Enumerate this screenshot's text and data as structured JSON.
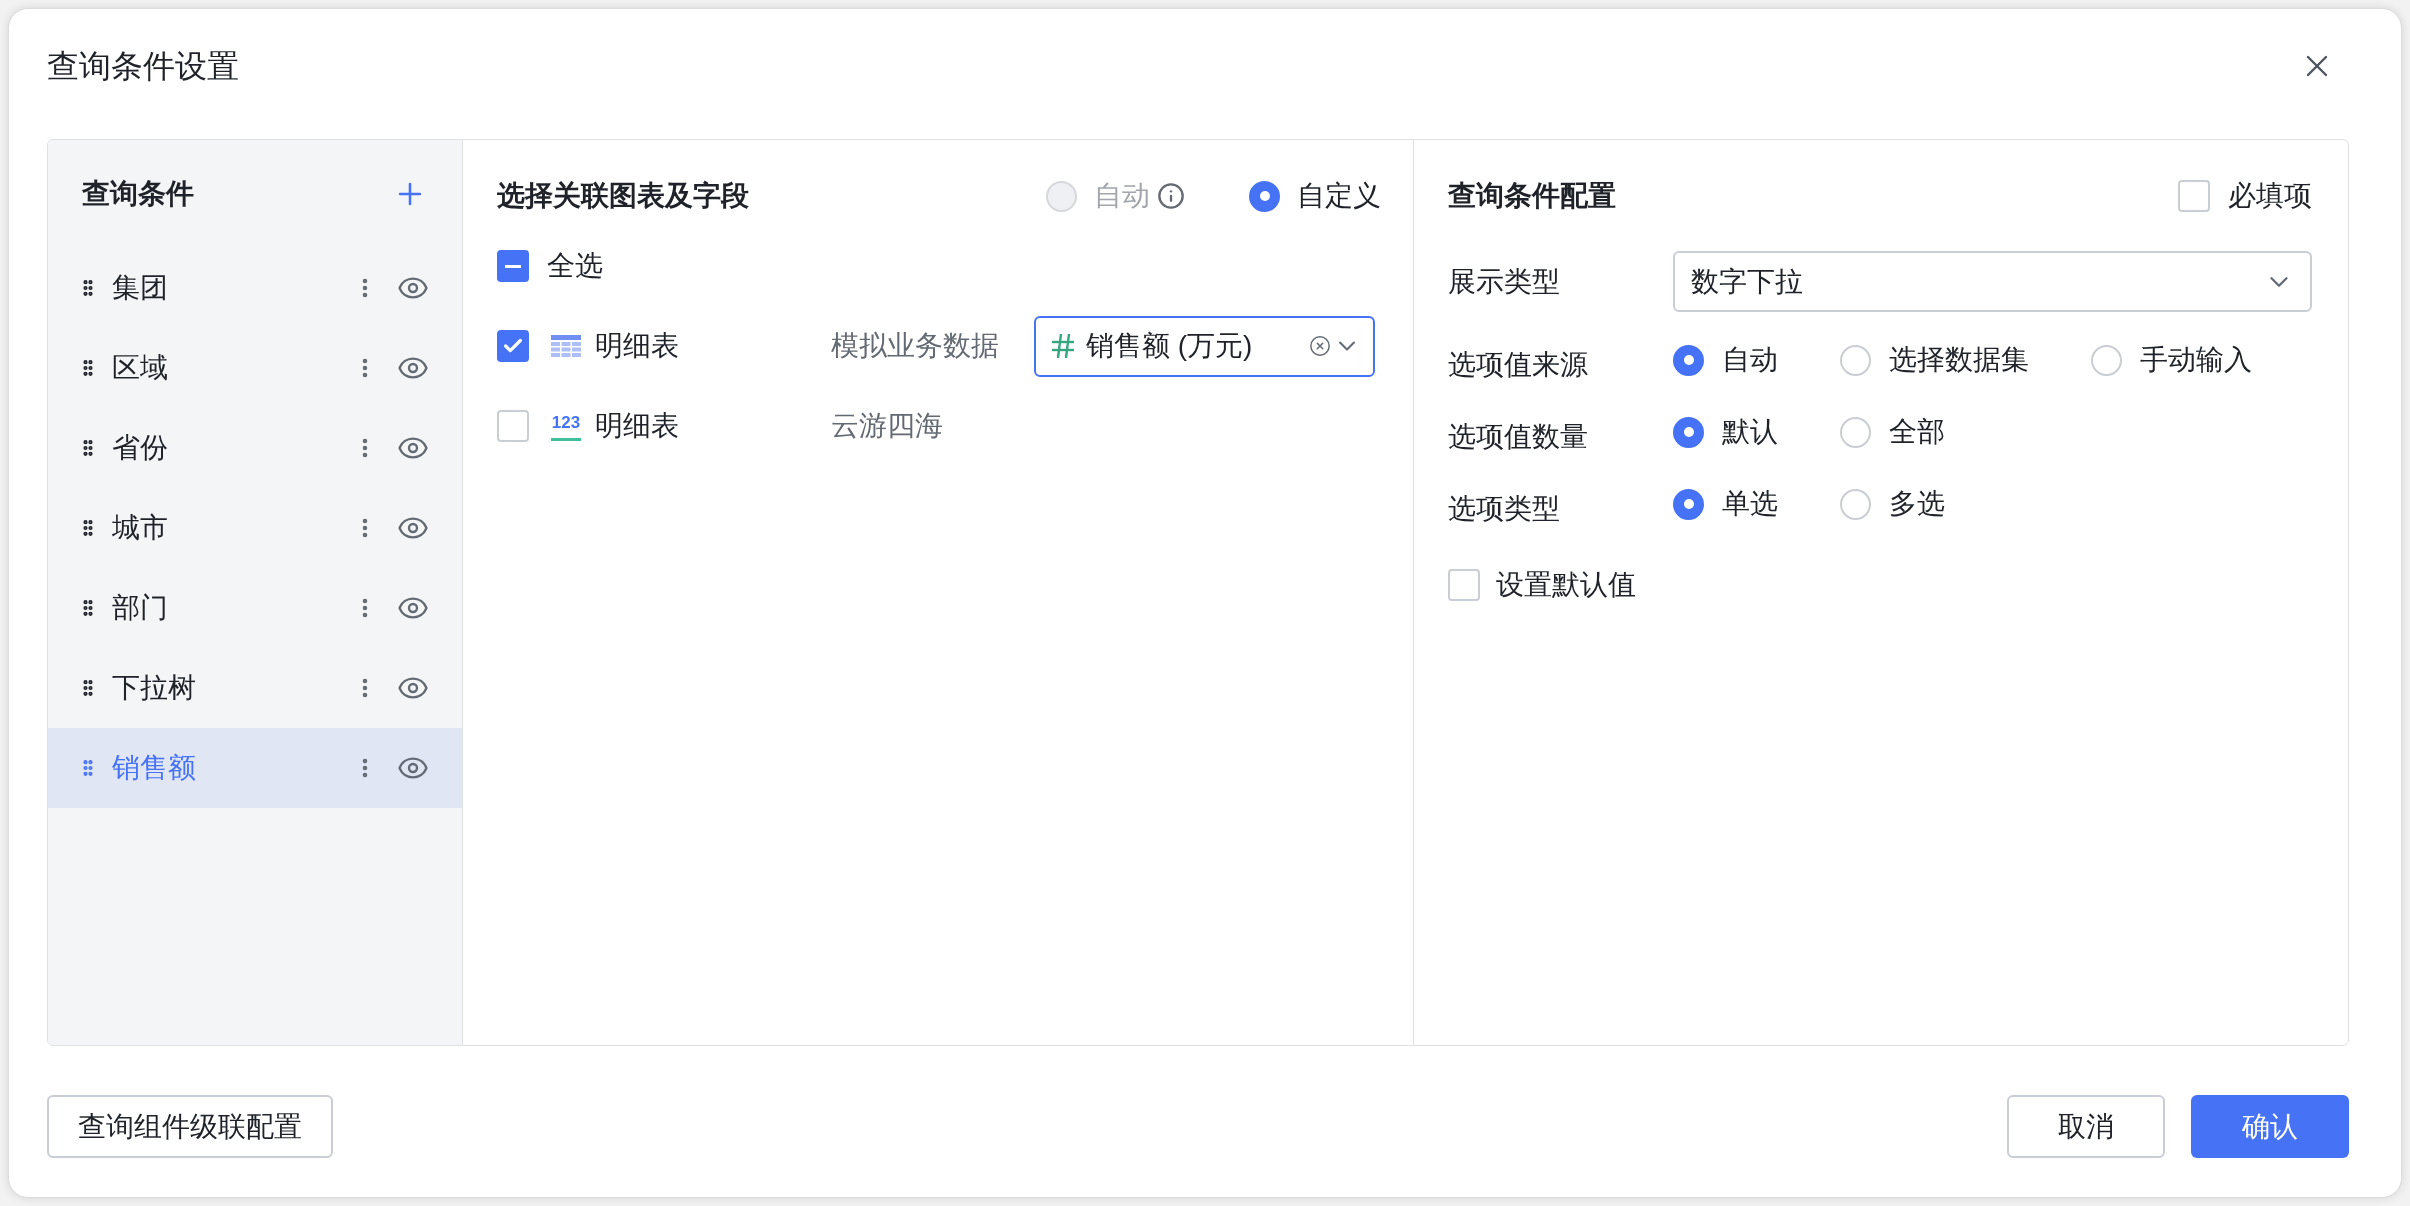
{
  "dialog": {
    "title": "查询条件设置"
  },
  "conditions": {
    "title": "查询条件",
    "items": [
      {
        "label": "集团",
        "selected": false
      },
      {
        "label": "区域",
        "selected": false
      },
      {
        "label": "省份",
        "selected": false
      },
      {
        "label": "城市",
        "selected": false
      },
      {
        "label": "部门",
        "selected": false
      },
      {
        "label": "下拉树",
        "selected": false
      },
      {
        "label": "销售额",
        "selected": true
      }
    ]
  },
  "linking": {
    "title": "选择关联图表及字段",
    "modes": [
      {
        "label": "自动",
        "selected": false,
        "disabled": true
      },
      {
        "label": "自定义",
        "selected": true,
        "disabled": false
      }
    ],
    "select_all": {
      "label": "全选",
      "indeterminate": true
    },
    "charts": [
      {
        "kind": "table",
        "checked": true,
        "name": "明细表",
        "dataset": "模拟业务数据",
        "field": {
          "value": "销售额 (万元)"
        }
      },
      {
        "kind": "number",
        "checked": false,
        "icon_text": "123",
        "name": "明细表",
        "dataset": "云游四海"
      }
    ]
  },
  "config": {
    "title": "查询条件配置",
    "required": {
      "label": "必填项",
      "checked": false
    },
    "display_type": {
      "label": "展示类型",
      "value": "数字下拉"
    },
    "option_groups": [
      {
        "label": "选项值来源",
        "options": [
          {
            "label": "自动",
            "selected": true
          },
          {
            "label": "选择数据集",
            "selected": false
          },
          {
            "label": "手动输入",
            "selected": false
          }
        ]
      },
      {
        "label": "选项值数量",
        "options": [
          {
            "label": "默认",
            "selected": true
          },
          {
            "label": "全部",
            "selected": false
          }
        ]
      },
      {
        "label": "选项类型",
        "options": [
          {
            "label": "单选",
            "selected": true
          },
          {
            "label": "多选",
            "selected": false
          }
        ]
      }
    ],
    "default_value": {
      "label": "设置默认值",
      "checked": false
    }
  },
  "footer": {
    "cascade_button": "查询组件级联配置",
    "cancel_button": "取消",
    "confirm_button": "确认"
  }
}
